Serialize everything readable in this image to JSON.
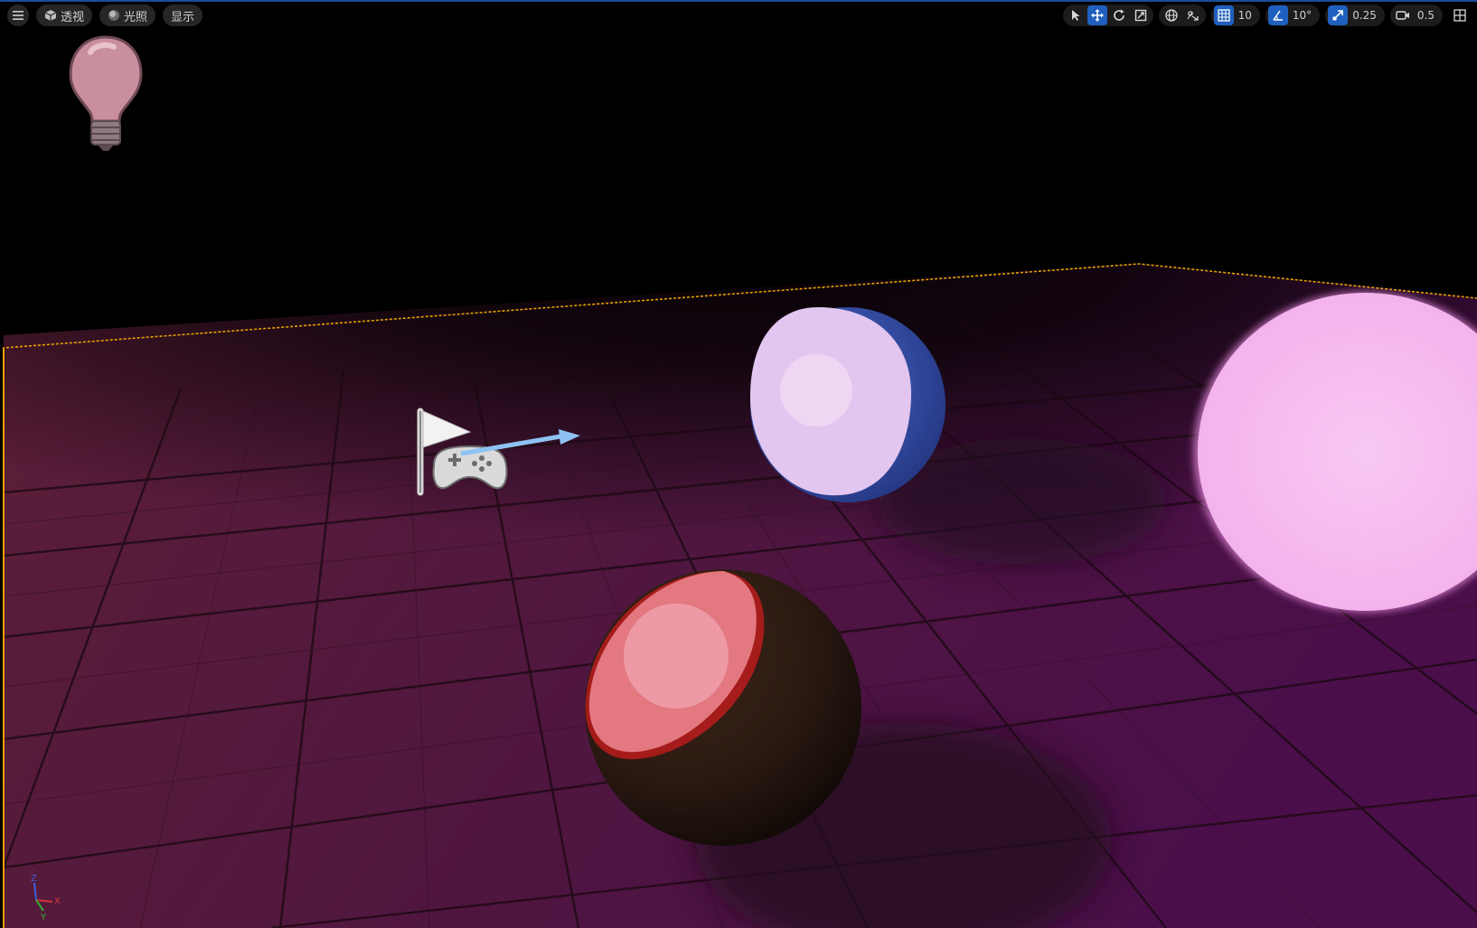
{
  "viewport": {
    "menu_icon": "hamburger-icon",
    "view_mode": {
      "icon": "cube-icon",
      "label": "透视"
    },
    "lighting": {
      "icon": "sphere-icon",
      "label": "光照"
    },
    "show": {
      "label": "显示"
    }
  },
  "toolbar": {
    "tools": [
      {
        "name": "select",
        "icon": "cursor-icon",
        "active": false
      },
      {
        "name": "translate",
        "icon": "move-icon",
        "active": true
      },
      {
        "name": "rotate",
        "icon": "rotate-icon",
        "active": false
      },
      {
        "name": "scale",
        "icon": "scale-icon",
        "active": false
      }
    ],
    "world_local_icon": "globe-icon",
    "surface_snap_icon": "surface-snap-icon",
    "grid_snap": {
      "icon": "grid-icon",
      "value": "10"
    },
    "rotation_snap": {
      "icon": "angle-icon",
      "value": "10°"
    },
    "scale_snap": {
      "icon": "scale-snap-icon",
      "value": "0.25"
    },
    "camera_speed": {
      "icon": "camera-icon",
      "value": "0.5"
    },
    "layout_icon": "layout-icon"
  },
  "colors": {
    "active": "#1f5fbf",
    "selection_outline": "#e8a000",
    "floor_near": "#5c1f37",
    "floor_far": "#4a0f4a",
    "sphere_red": "#e07a85",
    "sphere_dark": "#3a2217",
    "sphere_blue": "#3d5bbd",
    "sphere_lilac": "#e6c8f0",
    "sphere_pink": "#f7b8f0"
  },
  "scene_objects": [
    {
      "type": "point-light",
      "icon": "light-bulb-icon"
    },
    {
      "type": "player-start",
      "icon": "player-start-icon"
    },
    {
      "type": "sphere",
      "material": "red-dark"
    },
    {
      "type": "sphere",
      "material": "lilac-blue"
    },
    {
      "type": "sphere",
      "material": "pink-emissive"
    }
  ],
  "axis_gizmo": {
    "x": "X",
    "y": "Y",
    "z": "Z"
  }
}
